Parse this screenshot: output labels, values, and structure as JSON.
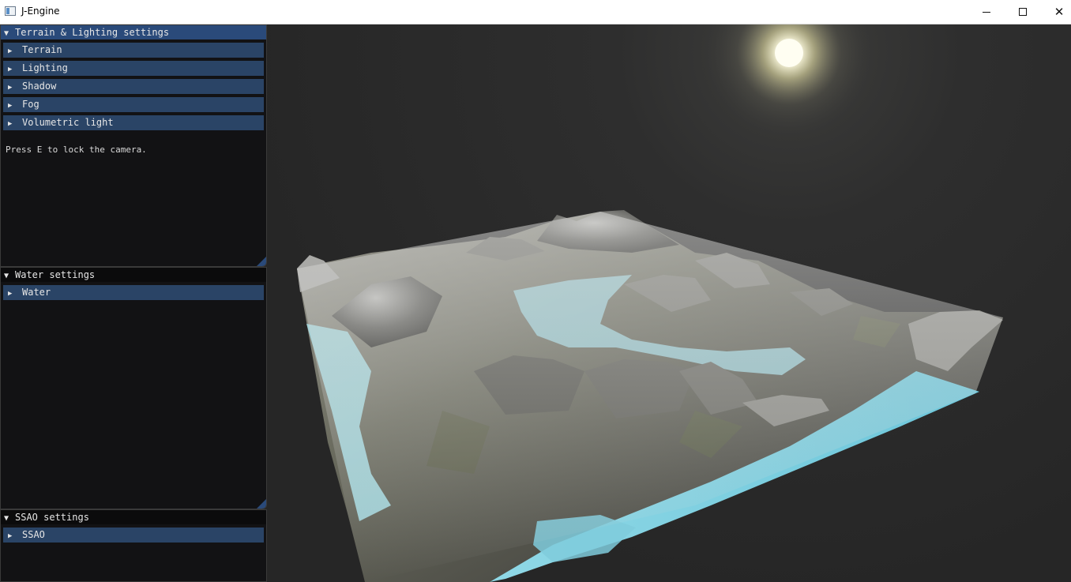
{
  "window": {
    "title": "J-Engine",
    "controls": {
      "minimize_icon": "minimize-icon",
      "maximize_icon": "maximize-icon",
      "close_glyph": "✕"
    }
  },
  "panels": {
    "terrain_lighting": {
      "title": "Terrain & Lighting settings",
      "sections": [
        "Terrain",
        "Lighting",
        "Shadow",
        "Fog",
        "Volumetric light"
      ],
      "hint": "Press E to lock the camera."
    },
    "water": {
      "title": "Water settings",
      "sections": [
        "Water"
      ]
    },
    "ssao": {
      "title": "SSAO settings",
      "sections": [
        "SSAO"
      ]
    }
  },
  "glyphs": {
    "open_arrow": "▼",
    "closed_arrow": "▶"
  },
  "colors": {
    "title_active": "#2a4a7a",
    "section_bg": "#2a4466",
    "panel_bg": "#121214",
    "water": "#7fd0e0",
    "sun": "#fffde6"
  }
}
